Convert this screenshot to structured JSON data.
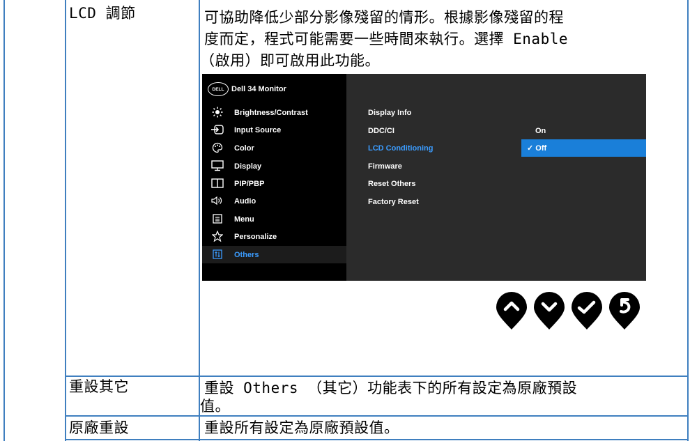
{
  "rows": [
    {
      "label": "LCD 調節",
      "desc_lines": [
        "可協助降低少部分影像殘留的情形。根據影像殘留的程",
        "度而定，程式可能需要一些時間來執行。選擇 Enable",
        "（啟用）即可啟用此功能。"
      ]
    },
    {
      "label": "重設其它",
      "desc_lines": [
        "重設 Others （其它）功能表下的所有設定為原廠預設",
        "值。"
      ]
    },
    {
      "label": "原廠重設",
      "desc_lines": [
        "重設所有設定為原廠預設值。"
      ]
    }
  ],
  "osd": {
    "logo": "DELL",
    "title": "Dell 34 Monitor",
    "menu": [
      {
        "label": "Brightness/Contrast",
        "icon": "sun-icon"
      },
      {
        "label": "Input Source",
        "icon": "input-source-icon"
      },
      {
        "label": "Color",
        "icon": "palette-icon"
      },
      {
        "label": "Display",
        "icon": "monitor-icon"
      },
      {
        "label": "PIP/PBP",
        "icon": "pip-icon"
      },
      {
        "label": "Audio",
        "icon": "speaker-icon"
      },
      {
        "label": "Menu",
        "icon": "menu-icon"
      },
      {
        "label": "Personalize",
        "icon": "star-icon"
      },
      {
        "label": "Others",
        "icon": "others-icon",
        "active": true
      }
    ],
    "submenu": [
      {
        "label": "Display Info"
      },
      {
        "label": "DDC/CI"
      },
      {
        "label": "LCD Conditioning",
        "active": true
      },
      {
        "label": "Firmware"
      },
      {
        "label": "Reset Others"
      },
      {
        "label": "Factory Reset"
      }
    ],
    "options": {
      "on": "On",
      "off": "✓ Off"
    },
    "colors": {
      "active_text": "#3b9cff",
      "selected_bg": "#1a7fd9",
      "panel_right": "#2b2b2b"
    }
  },
  "nav_buttons": [
    "up-arrow-icon",
    "down-arrow-icon",
    "check-icon",
    "back-icon"
  ],
  "border_color": "#3f7fbf"
}
